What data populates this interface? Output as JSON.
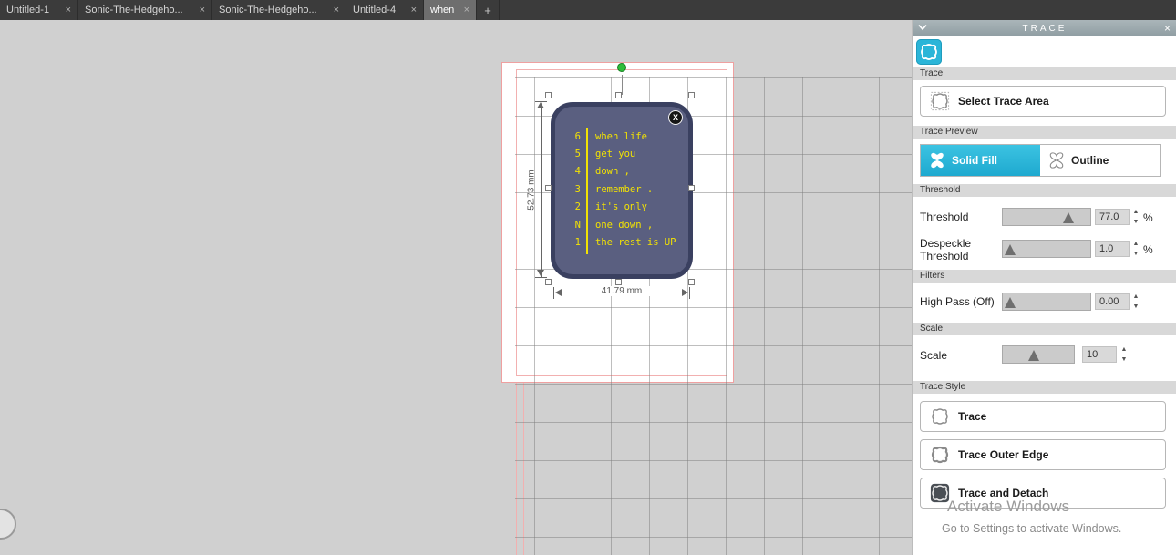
{
  "tab_bar": {
    "close_glyph": "×",
    "new_tab_label": "+",
    "tabs": [
      {
        "label": "Untitled-1"
      },
      {
        "label": "Sonic-The-Hedgeho..."
      },
      {
        "label": "Sonic-The-Hedgeho..."
      },
      {
        "label": "Untitled-4"
      },
      {
        "label": "when"
      }
    ]
  },
  "canvas": {
    "dim_height": "52.73 mm",
    "dim_width": "41.79 mm",
    "design": {
      "close_badge": "X",
      "rows": [
        {
          "num": "6",
          "text": "when life"
        },
        {
          "num": "5",
          "text": "get you"
        },
        {
          "num": "4",
          "text": "down ,"
        },
        {
          "num": "3",
          "text": "remember ."
        },
        {
          "num": "2",
          "text": "it's only"
        },
        {
          "num": "N",
          "text": "one down ,"
        },
        {
          "num": "1",
          "text": "the rest is UP"
        }
      ]
    }
  },
  "trace_panel": {
    "title": "TRACE",
    "close_glyph": "×",
    "accent_color": "#2bb5d8",
    "sections": {
      "trace": "Trace",
      "trace_preview": "Trace Preview",
      "threshold": "Threshold",
      "filters": "Filters",
      "scale": "Scale",
      "trace_style": "Trace Style"
    },
    "select_trace_area": "Select Trace Area",
    "solid_fill": "Solid Fill",
    "outline": "Outline",
    "threshold": {
      "label": "Threshold",
      "value": "77.0",
      "unit": "%"
    },
    "despeckle": {
      "label": "Despeckle Threshold",
      "value": "1.0",
      "unit": "%"
    },
    "high_pass": {
      "label": "High Pass (Off)",
      "value": "0.00"
    },
    "scale": {
      "label": "Scale",
      "value": "10"
    },
    "style_buttons": [
      {
        "label": "Trace"
      },
      {
        "label": "Trace Outer Edge"
      },
      {
        "label": "Trace and Detach"
      }
    ]
  },
  "glyphs": {
    "up": "▲",
    "down": "▼"
  },
  "watermark": {
    "line1": "Activate Windows",
    "line2": "Go to Settings to activate Windows."
  }
}
